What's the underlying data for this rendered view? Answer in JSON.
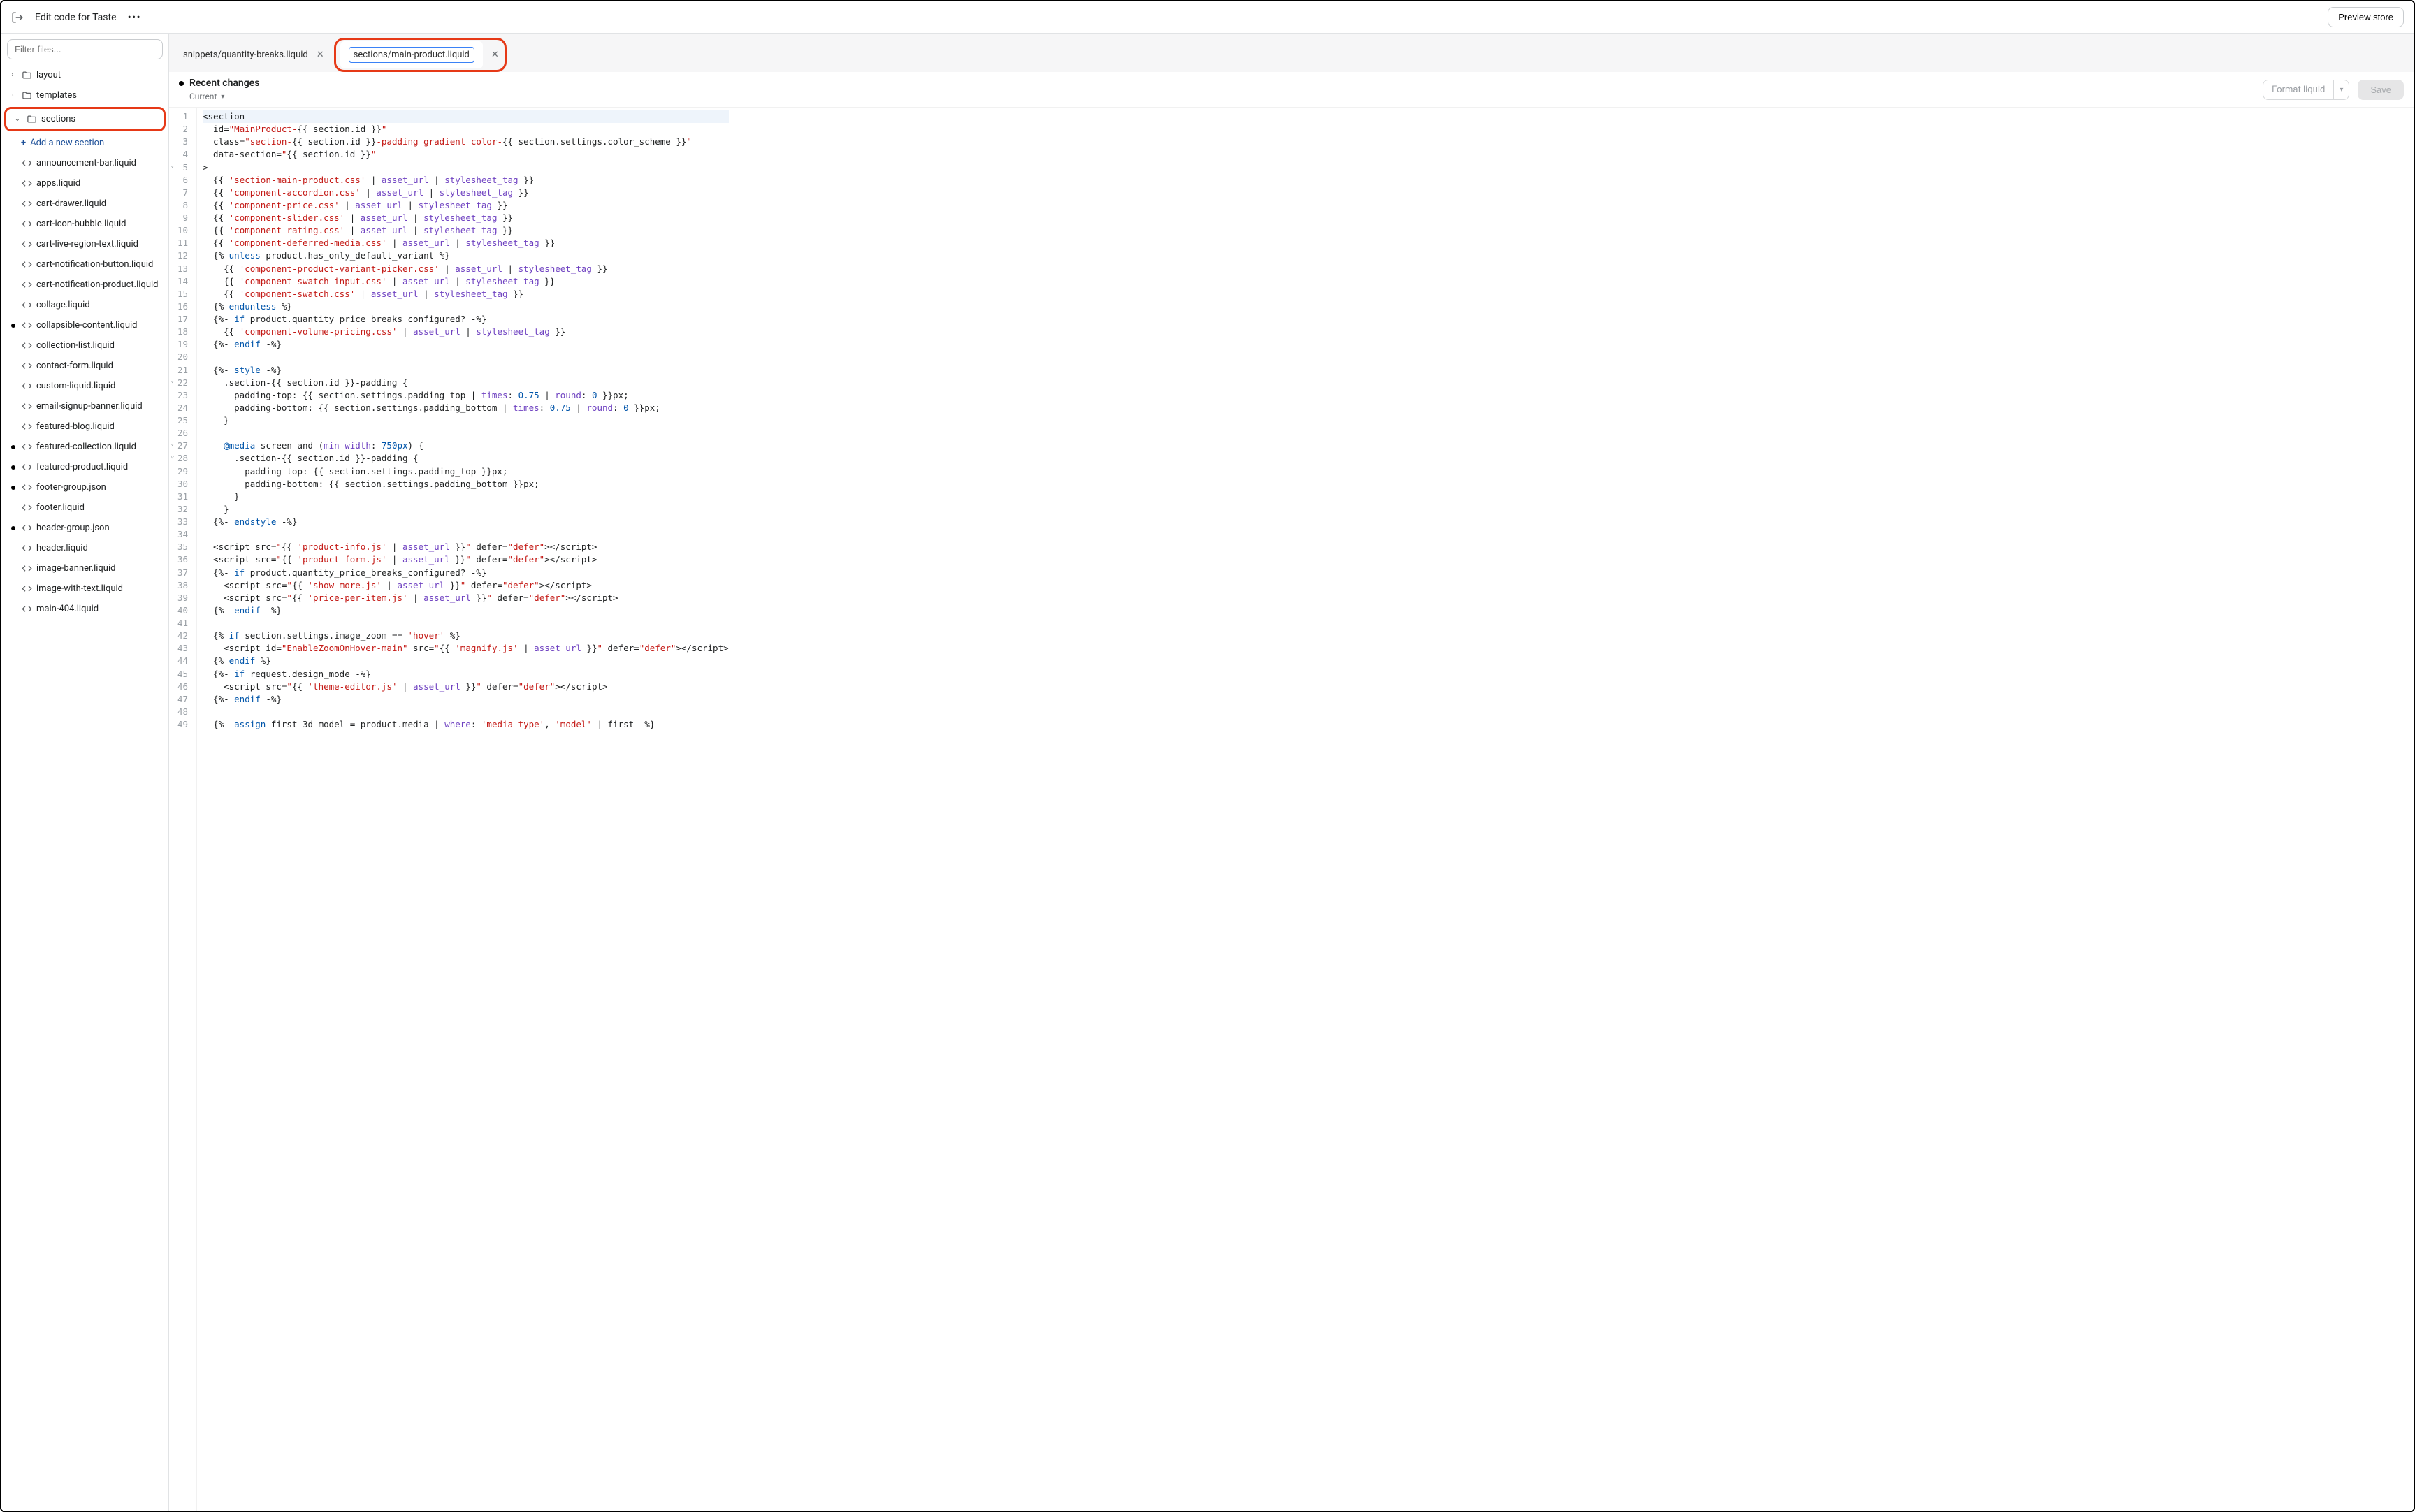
{
  "topbar": {
    "title": "Edit code for Taste",
    "preview_label": "Preview store"
  },
  "sidebar": {
    "filter_placeholder": "Filter files...",
    "folders": [
      {
        "name": "layout",
        "expanded": false
      },
      {
        "name": "templates",
        "expanded": false
      },
      {
        "name": "sections",
        "expanded": true,
        "highlighted": true
      }
    ],
    "add_section_label": "Add a new section",
    "files": [
      {
        "name": "announcement-bar.liquid",
        "icon": "code",
        "modified": false
      },
      {
        "name": "apps.liquid",
        "icon": "code",
        "modified": false
      },
      {
        "name": "cart-drawer.liquid",
        "icon": "code",
        "modified": false
      },
      {
        "name": "cart-icon-bubble.liquid",
        "icon": "code",
        "modified": false
      },
      {
        "name": "cart-live-region-text.liquid",
        "icon": "code",
        "modified": false
      },
      {
        "name": "cart-notification-button.liquid",
        "icon": "code",
        "modified": false
      },
      {
        "name": "cart-notification-product.liquid",
        "icon": "code",
        "modified": false
      },
      {
        "name": "collage.liquid",
        "icon": "code",
        "modified": false
      },
      {
        "name": "collapsible-content.liquid",
        "icon": "code",
        "modified": true
      },
      {
        "name": "collection-list.liquid",
        "icon": "code",
        "modified": false
      },
      {
        "name": "contact-form.liquid",
        "icon": "code",
        "modified": false
      },
      {
        "name": "custom-liquid.liquid",
        "icon": "code",
        "modified": false
      },
      {
        "name": "email-signup-banner.liquid",
        "icon": "code",
        "modified": false
      },
      {
        "name": "featured-blog.liquid",
        "icon": "code",
        "modified": false
      },
      {
        "name": "featured-collection.liquid",
        "icon": "code",
        "modified": true
      },
      {
        "name": "featured-product.liquid",
        "icon": "code",
        "modified": true
      },
      {
        "name": "footer-group.json",
        "icon": "code",
        "modified": true
      },
      {
        "name": "footer.liquid",
        "icon": "code",
        "modified": false
      },
      {
        "name": "header-group.json",
        "icon": "code",
        "modified": true
      },
      {
        "name": "header.liquid",
        "icon": "code",
        "modified": false
      },
      {
        "name": "image-banner.liquid",
        "icon": "code",
        "modified": false
      },
      {
        "name": "image-with-text.liquid",
        "icon": "code",
        "modified": false
      },
      {
        "name": "main-404.liquid",
        "icon": "code",
        "modified": false
      }
    ]
  },
  "tabs": [
    {
      "label": "snippets/quantity-breaks.liquid",
      "active": false
    },
    {
      "label": "sections/main-product.liquid",
      "active": true,
      "highlighted": true
    }
  ],
  "toolbar": {
    "recent_label": "Recent changes",
    "current_label": "Current",
    "format_label": "Format liquid",
    "save_label": "Save"
  },
  "code": {
    "lines": [
      {
        "n": 1,
        "hl": true,
        "html": "&lt;section"
      },
      {
        "n": 2,
        "html": "  id=<span class='s-str'>\"MainProduct-</span>{{ section.id }}<span class='s-str'>\"</span>"
      },
      {
        "n": 3,
        "html": "  class=<span class='s-str'>\"section-</span>{{ section.id }}<span class='s-str'>-padding gradient color-</span>{{ section.settings.color_scheme }}<span class='s-str'>\"</span>"
      },
      {
        "n": 4,
        "html": "  data-section=<span class='s-str'>\"</span>{{ section.id }}<span class='s-str'>\"</span>"
      },
      {
        "n": 5,
        "fold": true,
        "html": "&gt;"
      },
      {
        "n": 6,
        "html": "  {{ <span class='s-str'>'section-main-product.css'</span> | <span class='s-fn'>asset_url</span> | <span class='s-fn'>stylesheet_tag</span> }}"
      },
      {
        "n": 7,
        "html": "  {{ <span class='s-str'>'component-accordion.css'</span> | <span class='s-fn'>asset_url</span> | <span class='s-fn'>stylesheet_tag</span> }}"
      },
      {
        "n": 8,
        "html": "  {{ <span class='s-str'>'component-price.css'</span> | <span class='s-fn'>asset_url</span> | <span class='s-fn'>stylesheet_tag</span> }}"
      },
      {
        "n": 9,
        "html": "  {{ <span class='s-str'>'component-slider.css'</span> | <span class='s-fn'>asset_url</span> | <span class='s-fn'>stylesheet_tag</span> }}"
      },
      {
        "n": 10,
        "html": "  {{ <span class='s-str'>'component-rating.css'</span> | <span class='s-fn'>asset_url</span> | <span class='s-fn'>stylesheet_tag</span> }}"
      },
      {
        "n": 11,
        "html": "  {{ <span class='s-str'>'component-deferred-media.css'</span> | <span class='s-fn'>asset_url</span> | <span class='s-fn'>stylesheet_tag</span> }}"
      },
      {
        "n": 12,
        "html": "  {% <span class='s-kw'>unless</span> product.has_only_default_variant %}"
      },
      {
        "n": 13,
        "html": "    {{ <span class='s-str'>'component-product-variant-picker.css'</span> | <span class='s-fn'>asset_url</span> | <span class='s-fn'>stylesheet_tag</span> }}"
      },
      {
        "n": 14,
        "html": "    {{ <span class='s-str'>'component-swatch-input.css'</span> | <span class='s-fn'>asset_url</span> | <span class='s-fn'>stylesheet_tag</span> }}"
      },
      {
        "n": 15,
        "html": "    {{ <span class='s-str'>'component-swatch.css'</span> | <span class='s-fn'>asset_url</span> | <span class='s-fn'>stylesheet_tag</span> }}"
      },
      {
        "n": 16,
        "html": "  {% <span class='s-kw'>endunless</span> %}"
      },
      {
        "n": 17,
        "html": "  {%- <span class='s-kw'>if</span> product.quantity_price_breaks_configured? -%}"
      },
      {
        "n": 18,
        "html": "    {{ <span class='s-str'>'component-volume-pricing.css'</span> | <span class='s-fn'>asset_url</span> | <span class='s-fn'>stylesheet_tag</span> }}"
      },
      {
        "n": 19,
        "html": "  {%- <span class='s-kw'>endif</span> -%}"
      },
      {
        "n": 20,
        "html": ""
      },
      {
        "n": 21,
        "html": "  {%- <span class='s-kw'>style</span> -%}"
      },
      {
        "n": 22,
        "fold": true,
        "html": "    .section-{{ section.id }}-padding {"
      },
      {
        "n": 23,
        "html": "      padding-top: {{ section.settings.padding_top | <span class='s-fn'>times</span>: <span class='s-num'>0.75</span> | <span class='s-fn'>round</span>: <span class='s-num'>0</span> }}px;"
      },
      {
        "n": 24,
        "html": "      padding-bottom: {{ section.settings.padding_bottom | <span class='s-fn'>times</span>: <span class='s-num'>0.75</span> | <span class='s-fn'>round</span>: <span class='s-num'>0</span> }}px;"
      },
      {
        "n": 25,
        "html": "    }"
      },
      {
        "n": 26,
        "html": ""
      },
      {
        "n": 27,
        "fold": true,
        "html": "    <span class='s-kw'>@media</span> screen and (<span class='s-fn'>min-width</span>: <span class='s-num'>750px</span>) {"
      },
      {
        "n": 28,
        "fold": true,
        "html": "      .section-{{ section.id }}-padding {"
      },
      {
        "n": 29,
        "html": "        padding-top: {{ section.settings.padding_top }}px;"
      },
      {
        "n": 30,
        "html": "        padding-bottom: {{ section.settings.padding_bottom }}px;"
      },
      {
        "n": 31,
        "html": "      }"
      },
      {
        "n": 32,
        "html": "    }"
      },
      {
        "n": 33,
        "html": "  {%- <span class='s-kw'>endstyle</span> -%}"
      },
      {
        "n": 34,
        "html": ""
      },
      {
        "n": 35,
        "html": "  &lt;script src=<span class='s-str'>\"</span>{{ <span class='s-str'>'product-info.js'</span> | <span class='s-fn'>asset_url</span> }}<span class='s-str'>\"</span> defer=<span class='s-str'>\"defer\"</span>&gt;&lt;/script&gt;"
      },
      {
        "n": 36,
        "html": "  &lt;script src=<span class='s-str'>\"</span>{{ <span class='s-str'>'product-form.js'</span> | <span class='s-fn'>asset_url</span> }}<span class='s-str'>\"</span> defer=<span class='s-str'>\"defer\"</span>&gt;&lt;/script&gt;"
      },
      {
        "n": 37,
        "html": "  {%- <span class='s-kw'>if</span> product.quantity_price_breaks_configured? -%}"
      },
      {
        "n": 38,
        "html": "    &lt;script src=<span class='s-str'>\"</span>{{ <span class='s-str'>'show-more.js'</span> | <span class='s-fn'>asset_url</span> }}<span class='s-str'>\"</span> defer=<span class='s-str'>\"defer\"</span>&gt;&lt;/script&gt;"
      },
      {
        "n": 39,
        "html": "    &lt;script src=<span class='s-str'>\"</span>{{ <span class='s-str'>'price-per-item.js'</span> | <span class='s-fn'>asset_url</span> }}<span class='s-str'>\"</span> defer=<span class='s-str'>\"defer\"</span>&gt;&lt;/script&gt;"
      },
      {
        "n": 40,
        "html": "  {%- <span class='s-kw'>endif</span> -%}"
      },
      {
        "n": 41,
        "html": ""
      },
      {
        "n": 42,
        "html": "  {% <span class='s-kw'>if</span> section.settings.image_zoom == <span class='s-str'>'hover'</span> %}"
      },
      {
        "n": 43,
        "html": "    &lt;script id=<span class='s-str'>\"EnableZoomOnHover-main\"</span> src=<span class='s-str'>\"</span>{{ <span class='s-str'>'magnify.js'</span> | <span class='s-fn'>asset_url</span> }}<span class='s-str'>\"</span> defer=<span class='s-str'>\"defer\"</span>&gt;&lt;/script&gt;"
      },
      {
        "n": 44,
        "html": "  {% <span class='s-kw'>endif</span> %}"
      },
      {
        "n": 45,
        "html": "  {%- <span class='s-kw'>if</span> request.design_mode -%}"
      },
      {
        "n": 46,
        "html": "    &lt;script src=<span class='s-str'>\"</span>{{ <span class='s-str'>'theme-editor.js'</span> | <span class='s-fn'>asset_url</span> }}<span class='s-str'>\"</span> defer=<span class='s-str'>\"defer\"</span>&gt;&lt;/script&gt;"
      },
      {
        "n": 47,
        "html": "  {%- <span class='s-kw'>endif</span> -%}"
      },
      {
        "n": 48,
        "html": ""
      },
      {
        "n": 49,
        "html": "  {%- <span class='s-kw'>assign</span> first_3d_model = product.media | <span class='s-fn'>where</span>: <span class='s-str'>'media_type'</span>, <span class='s-str'>'model'</span> | first -%}"
      }
    ]
  }
}
